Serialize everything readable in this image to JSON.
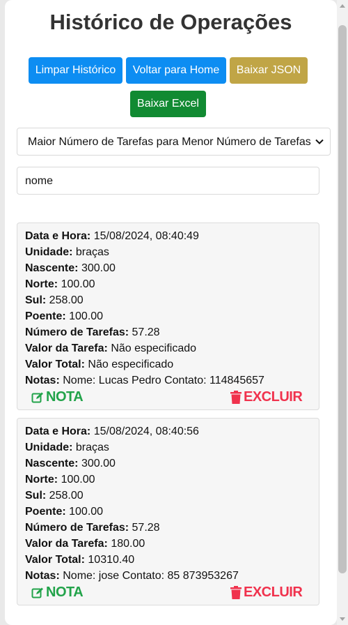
{
  "page": {
    "title": "Histórico de Operações"
  },
  "buttons": {
    "clear": "Limpar Histórico",
    "home": "Voltar para Home",
    "json": "Baixar JSON",
    "excel": "Baixar Excel"
  },
  "sort": {
    "selected": "Maior Número de Tarefas para Menor Número de Tarefas"
  },
  "search": {
    "value": "nome"
  },
  "labels": {
    "datetime": "Data e Hora:",
    "unit": "Unidade:",
    "east": "Nascente:",
    "north": "Norte:",
    "south": "Sul:",
    "west": "Poente:",
    "tasks": "Número de Tarefas:",
    "task_value": "Valor da Tarefa:",
    "total": "Valor Total:",
    "notes": "Notas:"
  },
  "actions": {
    "note": "NOTA",
    "delete": "EXCLUIR"
  },
  "colors": {
    "blue_button": "#0d8df2",
    "gold_button": "#c0a546",
    "green_button": "#118a32",
    "note_action": "#22a34a",
    "delete_action": "#f0324d"
  },
  "icons": {
    "note": "edit-icon",
    "delete": "trash-icon",
    "select": "chevron-down-icon"
  },
  "history": [
    {
      "datetime": "15/08/2024, 08:40:49",
      "unit": "braças",
      "east": "300.00",
      "north": "100.00",
      "south": "258.00",
      "west": "100.00",
      "tasks": "57.28",
      "task_value": "Não especificado",
      "total": "Não especificado",
      "notes": "Nome: Lucas Pedro Contato: 114845657"
    },
    {
      "datetime": "15/08/2024, 08:40:56",
      "unit": "braças",
      "east": "300.00",
      "north": "100.00",
      "south": "258.00",
      "west": "100.00",
      "tasks": "57.28",
      "task_value": "180.00",
      "total": "10310.40",
      "notes": "Nome: jose Contato: 85 873953267"
    }
  ]
}
